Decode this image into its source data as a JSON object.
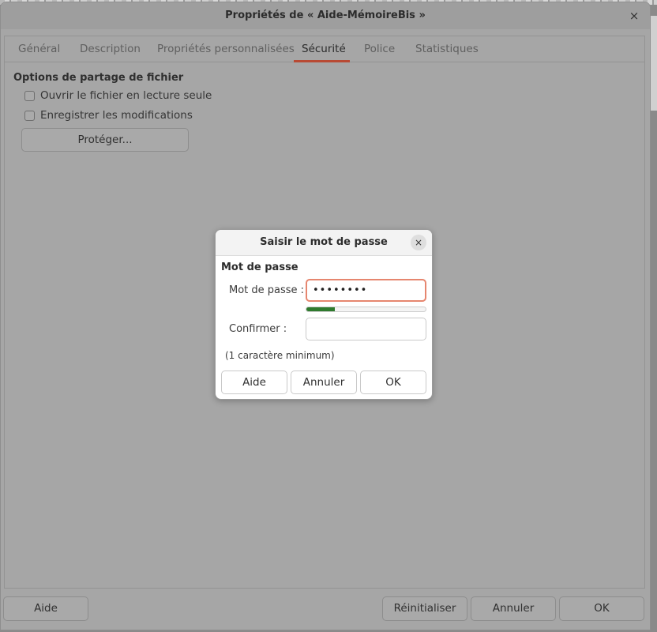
{
  "window": {
    "title": "Propriétés de « Aide-MémoireBis »",
    "close_glyph": "×"
  },
  "tabs": [
    {
      "label": "Général",
      "active": false
    },
    {
      "label": "Description",
      "active": false
    },
    {
      "label": "Propriétés personnalisées",
      "active": false
    },
    {
      "label": "Sécurité",
      "active": true
    },
    {
      "label": "Police",
      "active": false
    },
    {
      "label": "Statistiques",
      "active": false
    }
  ],
  "security": {
    "section_title": "Options de partage de fichier",
    "read_only_label": "Ouvrir le fichier en lecture seule",
    "read_only_checked": false,
    "record_changes_label": "Enregistrer les modifications",
    "record_changes_checked": false,
    "protect_button": "Protéger..."
  },
  "footer": {
    "help": "Aide",
    "reset": "Réinitialiser",
    "cancel": "Annuler",
    "ok": "OK"
  },
  "password_dialog": {
    "title": "Saisir le mot de passe",
    "close_glyph": "×",
    "section_title": "Mot de passe",
    "password_label": "Mot de passe :",
    "password_value": "••••••••",
    "strength_fraction": 0.24,
    "confirm_label": "Confirmer :",
    "confirm_value": "",
    "hint": "(1 caractère minimum)",
    "help": "Aide",
    "cancel": "Annuler",
    "ok": "OK"
  },
  "colors": {
    "accent_tab_underline": "#b84a34",
    "focus_border": "#e6866f",
    "strength_bar": "#2f7a2e"
  }
}
